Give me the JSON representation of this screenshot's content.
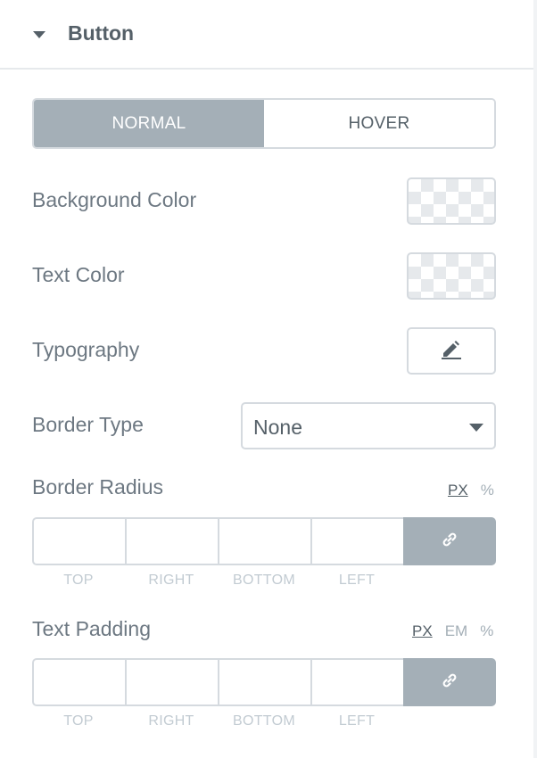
{
  "section": {
    "title": "Button"
  },
  "tabs": [
    {
      "label": "NORMAL",
      "active": true
    },
    {
      "label": "HOVER",
      "active": false
    }
  ],
  "rows": {
    "background_color": {
      "label": "Background Color"
    },
    "text_color": {
      "label": "Text Color"
    },
    "typography": {
      "label": "Typography",
      "icon": "pencil-icon"
    },
    "border_type": {
      "label": "Border Type",
      "value": "None",
      "icon": "chevron-down-icon"
    }
  },
  "border_radius": {
    "label": "Border Radius",
    "units": [
      {
        "label": "PX",
        "active": true
      },
      {
        "label": "%",
        "active": false
      }
    ],
    "fields": [
      "TOP",
      "RIGHT",
      "BOTTOM",
      "LEFT"
    ],
    "values": [
      "",
      "",
      "",
      ""
    ],
    "link_icon": "link-icon"
  },
  "text_padding": {
    "label": "Text Padding",
    "units": [
      {
        "label": "PX",
        "active": true
      },
      {
        "label": "EM",
        "active": false
      },
      {
        "label": "%",
        "active": false
      }
    ],
    "fields": [
      "TOP",
      "RIGHT",
      "BOTTOM",
      "LEFT"
    ],
    "values": [
      "",
      "",
      "",
      ""
    ],
    "link_icon": "link-icon"
  },
  "colors": {
    "active_tab_bg": "#a4afb7",
    "border": "#d5dadf",
    "label_text": "#6d7882",
    "heading_text": "#556068"
  }
}
